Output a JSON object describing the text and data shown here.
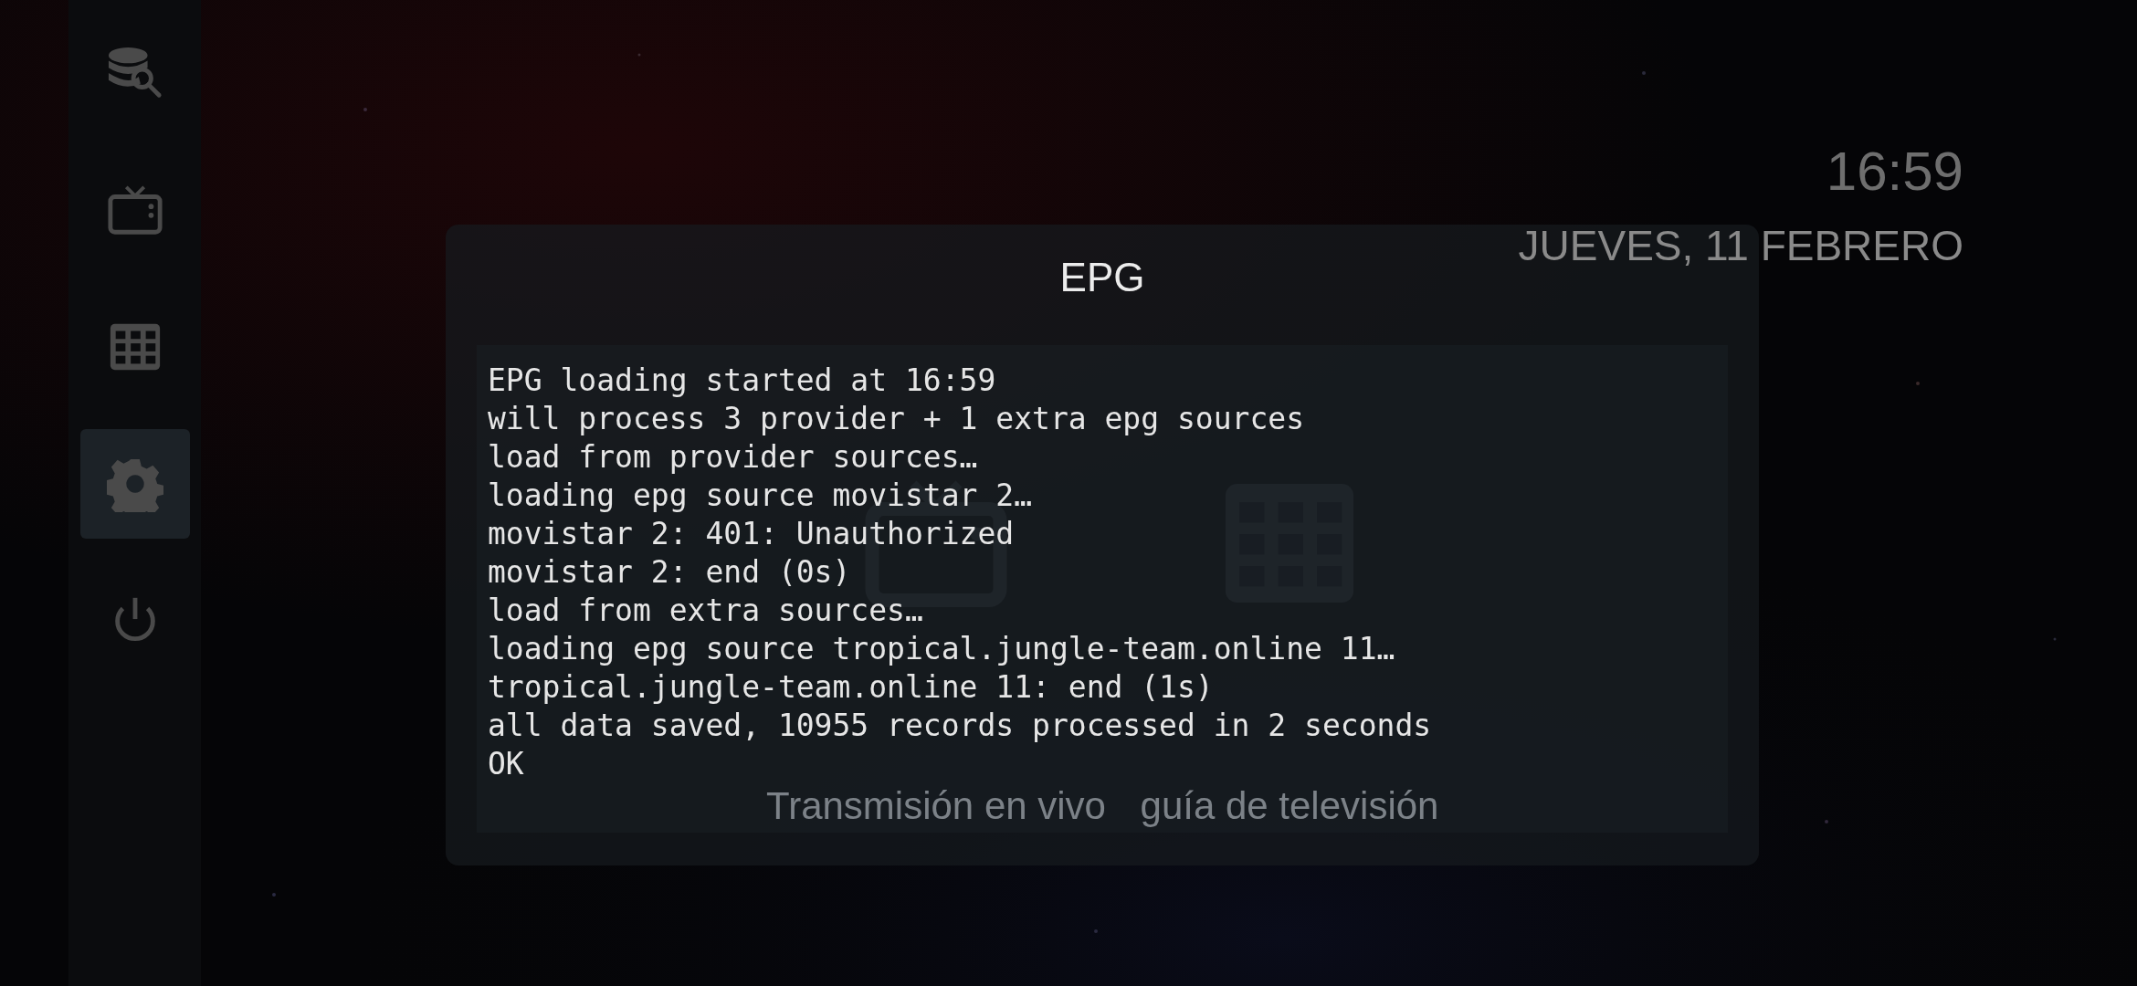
{
  "sidebar": {
    "items": [
      {
        "kind": "database-search",
        "selected": false
      },
      {
        "kind": "tv",
        "selected": false
      },
      {
        "kind": "grid",
        "selected": false
      },
      {
        "kind": "settings",
        "selected": true
      },
      {
        "kind": "power",
        "selected": false
      }
    ]
  },
  "clock": {
    "time": "16:59",
    "date": "JUEVES, 11 FEBRERO"
  },
  "tiles": [
    {
      "kind": "tv",
      "label": "Transmisión en vivo"
    },
    {
      "kind": "grid",
      "label": "guía de televisión"
    }
  ],
  "dialog": {
    "title": "EPG",
    "log": [
      "EPG loading started at 16:59",
      "will process 3 provider + 1 extra epg sources",
      "load from provider sources…",
      "loading epg source movistar 2…",
      "movistar 2: 401: Unauthorized",
      "movistar 2: end (0s)",
      "load from extra sources…",
      "loading epg source tropical.jungle-team.online 11…",
      "tropical.jungle-team.online 11: end (1s)",
      "all data saved, 10955 records processed in 2 seconds",
      "OK"
    ]
  }
}
